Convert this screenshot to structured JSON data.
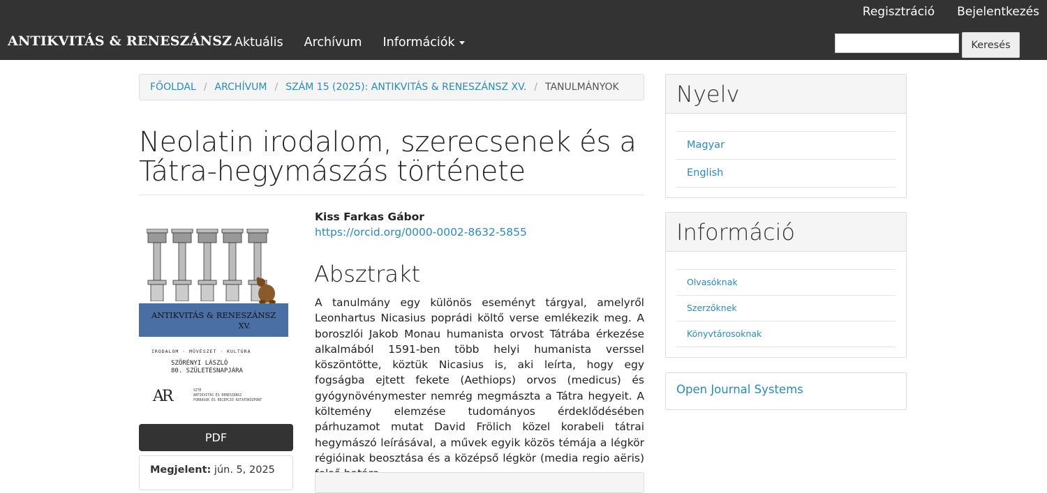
{
  "header": {
    "brand": "ANTIKVITÁS & RENESZÁNSZ",
    "user_nav": [
      "Regisztráció",
      "Bejelentkezés"
    ],
    "nav": [
      "Aktuális",
      "Archívum",
      "Információk"
    ],
    "search": {
      "placeholder": "",
      "button_label": "Keresés"
    }
  },
  "breadcrumb": {
    "items": [
      "Főoldal",
      "Archívum",
      "Szám 15 (2025): Antikvitás & Reneszánsz XV."
    ],
    "current": "Tanulmányok"
  },
  "article": {
    "title_line1": "Neolatin irodalom, szerecsenek és a",
    "title_line2": "Tátra-hegymászás története",
    "author": "Kiss Farkas Gábor",
    "orcid": "https://orcid.org/0000-0002-8632-5855",
    "abstract_heading": "Absztrakt",
    "abstract": "A tanulmány egy különös eseményt tárgyal, amelyről Leonhartus Nicasius poprádi költő verse emlékezik meg. A boroszlói Jakob Monau humanista orvost Tátrába érkezése alkalmából 1591-ben több helyi humanista verssel köszöntötte, köztük Nicasius is, aki leírta, hogy egy fogságba ejtett fekete (Aethiops) orvos (medicus) és gyógynövénymester nemrég megmászta a Tátra hegyeit. A költemény elemzése tudományos érdeklődésében párhuzamot mutat David Frölich közel korabeli tátrai hegymászó leírásával, a művek egyik közös témája a légkör régióinak beosztása és a középső légkör (media regio aëris) felső határa.",
    "pdf_label": "PDF",
    "published_label": "Megjelent:",
    "published_date": "jún. 5, 2025"
  },
  "cover": {
    "band_title": "ANTIKVITÁS & RENESZÁNSZ",
    "band_volume": "XV.",
    "subtitle": "IRODALOM · MŰVÉSZET · KULTÚRA",
    "dedication_line1": "SZÖRÉNYI LÁSZLÓ",
    "dedication_line2": "80. SZÜLETÉSNAPJÁRA",
    "logo": "AR",
    "institution_line1": "SZTE",
    "institution_line2": "ANTIKVITÁS ÉS RENESZÁNSZ",
    "institution_line3": "FORRÁSOK ÉS RECEPCIÓ KUTATÓKÖZPONT",
    "band_color": "#4a6fa5"
  },
  "sidebar": {
    "language": {
      "title": "Nyelv",
      "items": [
        "Magyar",
        "English"
      ]
    },
    "information": {
      "title": "Információ",
      "items": [
        "Olvasóknak",
        "Szerzőknek",
        "Könyvtárosoknak"
      ]
    },
    "ojs_link": "Open Journal Systems"
  },
  "colors": {
    "navbar": "#333333",
    "link": "#2a8ab8",
    "panel_bg": "#f5f5f5"
  }
}
